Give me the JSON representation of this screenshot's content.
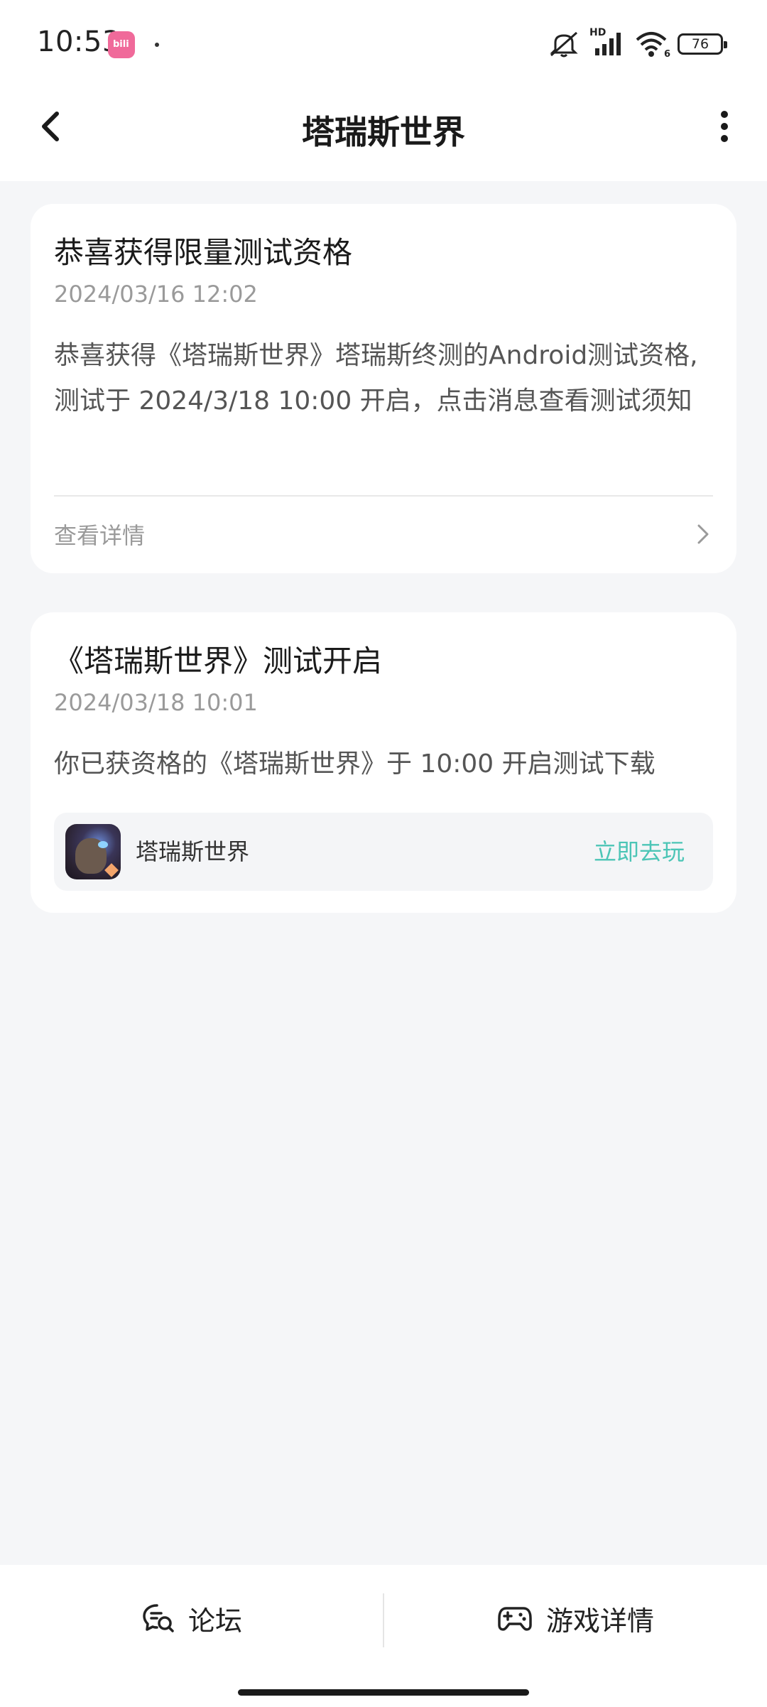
{
  "status_bar": {
    "time": "10:53",
    "app_badge": "bili",
    "network": "HD",
    "wifi_sub": "6",
    "battery": "76"
  },
  "header": {
    "title": "塔瑞斯世界",
    "back_icon": "chevron-left-icon",
    "more_icon": "more-vertical-icon"
  },
  "cards": [
    {
      "title": "恭喜获得限量测试资格",
      "time": "2024/03/16 12:02",
      "body": "恭喜获得《塔瑞斯世界》塔瑞斯终测的Android测试资格,测试于 2024/3/18 10:00 开启，点击消息查看测试须知",
      "detail_label": "查看详情"
    },
    {
      "title": "《塔瑞斯世界》测试开启",
      "time": "2024/03/18 10:01",
      "body": "你已获资格的《塔瑞斯世界》于 10:00 开启测试下载",
      "game_name": "塔瑞斯世界",
      "play_label": "立即去玩"
    }
  ],
  "bottom_bar": {
    "forum_label": "论坛",
    "game_detail_label": "游戏详情"
  },
  "colors": {
    "accent": "#4cc5b6",
    "background": "#f5f6f8",
    "card": "#ffffff",
    "muted": "#9a9a9a"
  }
}
